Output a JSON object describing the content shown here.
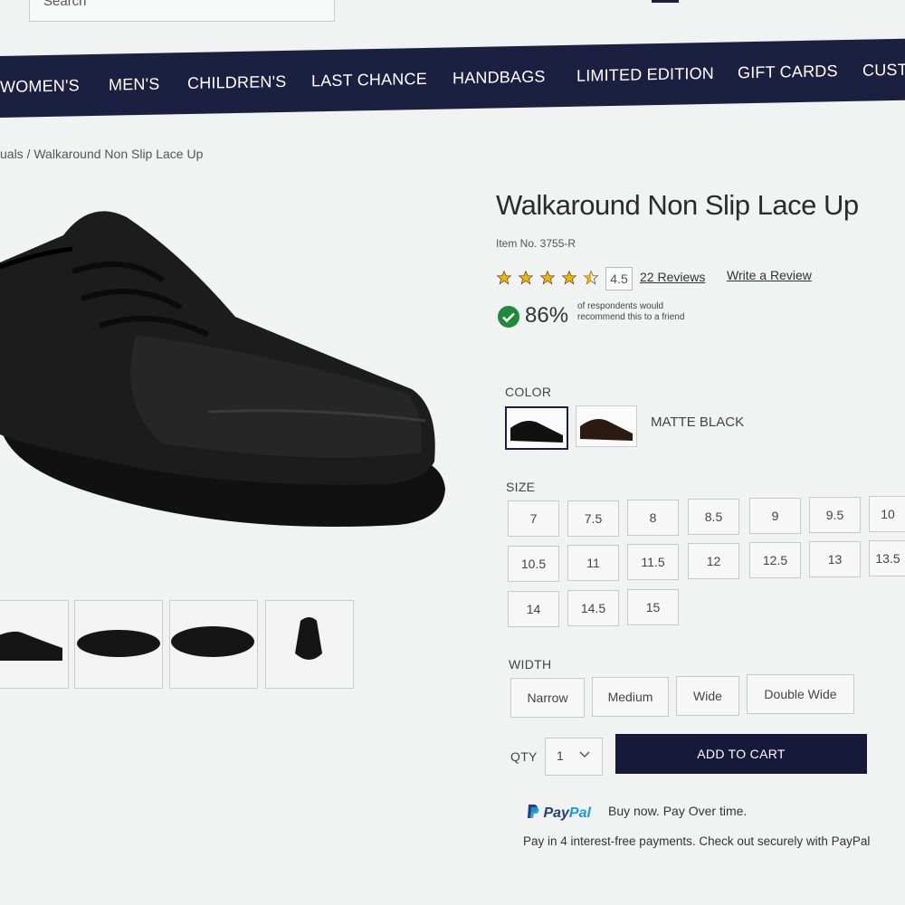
{
  "header": {
    "search_placeholder": "Search"
  },
  "nav": [
    "WOMEN'S",
    "MEN'S",
    "CHILDREN'S",
    "LAST CHANCE",
    "HANDBAGS",
    "LIMITED EDITION",
    "GIFT CARDS",
    "CUST"
  ],
  "breadcrumb": "uals / Walkaround Non Slip Lace Up",
  "product": {
    "title": "Walkaround Non Slip Lace Up",
    "item_no": "Item No. 3755-R",
    "rating": "4.5",
    "reviews_link": "22 Reviews",
    "write_review": "Write a Review",
    "recommend_pct": "86%",
    "recommend_note": "of respondents would recommend this to a friend"
  },
  "color": {
    "label": "COLOR",
    "selected": "MATTE BLACK"
  },
  "size": {
    "label": "SIZE",
    "options": [
      "7",
      "7.5",
      "8",
      "8.5",
      "9",
      "9.5",
      "10",
      "10.5",
      "11",
      "11.5",
      "12",
      "12.5",
      "13",
      "13.5",
      "14",
      "14.5",
      "15"
    ]
  },
  "width": {
    "label": "WIDTH",
    "options": [
      "Narrow",
      "Medium",
      "Wide",
      "Double Wide"
    ]
  },
  "qty": {
    "label": "QTY",
    "value": "1"
  },
  "cart": {
    "label": "ADD TO CART"
  },
  "paypal": {
    "brand_pay": "Pay",
    "brand_pal": "Pal",
    "tagline": "Buy now. Pay Over time.",
    "sub": "Pay in 4 interest-free payments. Check out securely with PayPal"
  }
}
